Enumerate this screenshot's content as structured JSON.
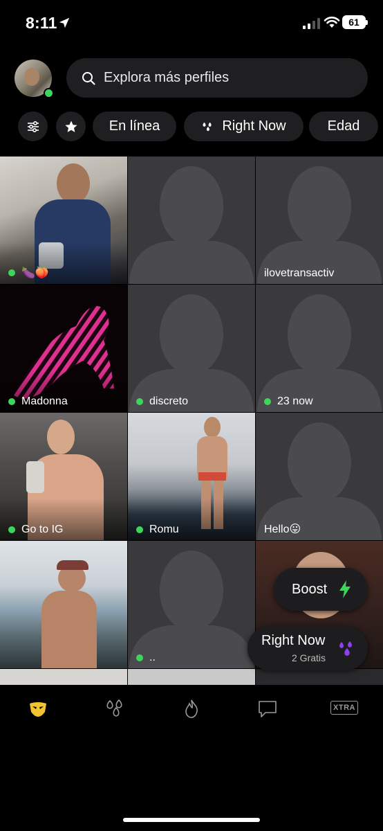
{
  "status_bar": {
    "time": "8:11",
    "battery": "61"
  },
  "header": {
    "search_placeholder": "Explora más perfiles"
  },
  "filters": [
    {
      "label": "En línea"
    },
    {
      "label": "Right Now"
    },
    {
      "label": "Edad"
    }
  ],
  "grid": {
    "profiles": [
      {
        "name": "",
        "online": true,
        "emojis": "🍆🍑",
        "kind": "photo"
      },
      {
        "name": "",
        "online": false,
        "kind": "placeholder"
      },
      {
        "name": "ilovetransactiv",
        "online": false,
        "kind": "placeholder"
      },
      {
        "name": "Madonna",
        "online": true,
        "kind": "photo"
      },
      {
        "name": "discreto",
        "online": true,
        "kind": "placeholder"
      },
      {
        "name": "23 now",
        "online": true,
        "kind": "placeholder"
      },
      {
        "name": "Go to IG",
        "online": true,
        "kind": "photo"
      },
      {
        "name": "Romu",
        "online": true,
        "kind": "photo"
      },
      {
        "name": "Hello😛",
        "online": false,
        "kind": "placeholder"
      },
      {
        "name": "",
        "online": false,
        "kind": "photo"
      },
      {
        "name": "..",
        "online": true,
        "kind": "placeholder"
      },
      {
        "name": "",
        "online": false,
        "kind": "photo"
      }
    ]
  },
  "floating": {
    "boost_label": "Boost",
    "right_now_label": "Right Now",
    "right_now_sub": "2 Gratis"
  },
  "nav": {
    "items": [
      "grindr-mask-icon",
      "right-now-icon",
      "flame-icon",
      "chat-icon"
    ],
    "xtra_label": "XTRA"
  },
  "colors": {
    "online": "#3ed65a",
    "accent_yellow": "#f4c430",
    "right_now_purple": "#8e3ff0",
    "boost_green": "#3ed65a"
  }
}
